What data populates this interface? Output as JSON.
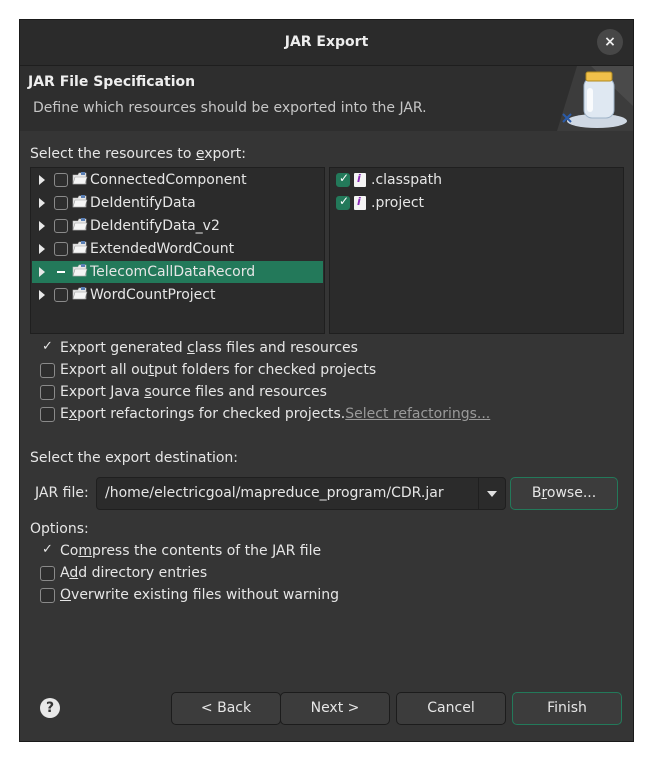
{
  "window": {
    "title": "JAR Export",
    "close_icon": "×"
  },
  "header": {
    "title": "JAR File Specification",
    "description": "Define which resources should be exported into the JAR."
  },
  "resources": {
    "label_pre": "Select the resources to ",
    "label_mn": "e",
    "label_post": "xport:",
    "projects": [
      {
        "name": "ConnectedComponent",
        "state": "unchecked",
        "selected": false
      },
      {
        "name": "DeIdentifyData",
        "state": "unchecked",
        "selected": false
      },
      {
        "name": "DeIdentifyData_v2",
        "state": "unchecked",
        "selected": false
      },
      {
        "name": "ExtendedWordCount",
        "state": "unchecked",
        "selected": false
      },
      {
        "name": "TelecomCallDataRecord",
        "state": "partial",
        "selected": true
      },
      {
        "name": "WordCountProject",
        "state": "unchecked",
        "selected": false
      }
    ],
    "files": [
      {
        "name": ".classpath",
        "checked": true
      },
      {
        "name": ".project",
        "checked": true
      }
    ]
  },
  "export_options": [
    {
      "pre": "Export generated ",
      "mn": "c",
      "post": "lass files and resources",
      "checked": true
    },
    {
      "pre": "Export all ou",
      "mn": "t",
      "post": "put folders for checked projects",
      "checked": false
    },
    {
      "pre": "Export Java ",
      "mn": "s",
      "post": "ource files and resources",
      "checked": false
    },
    {
      "pre": "E",
      "mn": "x",
      "post": "port refactorings for checked projects.",
      "checked": false,
      "link": "Select refactorings..."
    }
  ],
  "destination": {
    "label": "Select the export destination:",
    "jar_label_mn": "J",
    "jar_label_post": "AR file:",
    "jar_path": "/home/electricgoal/mapreduce_program/CDR.jar",
    "browse_pre": "B",
    "browse_mn": "r",
    "browse_post": "owse..."
  },
  "options": {
    "label": "Options:",
    "items": [
      {
        "pre": "Co",
        "mn": "m",
        "post": "press the contents of the JAR file",
        "checked": true
      },
      {
        "pre": "A",
        "mn": "d",
        "post": "d directory entries",
        "checked": false
      },
      {
        "pre": "",
        "mn": "O",
        "post": "verwrite existing files without warning",
        "checked": false
      }
    ]
  },
  "footer": {
    "help_icon": "?",
    "back": "< Back",
    "next": "Next >",
    "cancel": "Cancel",
    "finish": "Finish"
  },
  "colors": {
    "accent": "#23795a",
    "background": "#353535",
    "panel": "#2b2b2b"
  }
}
